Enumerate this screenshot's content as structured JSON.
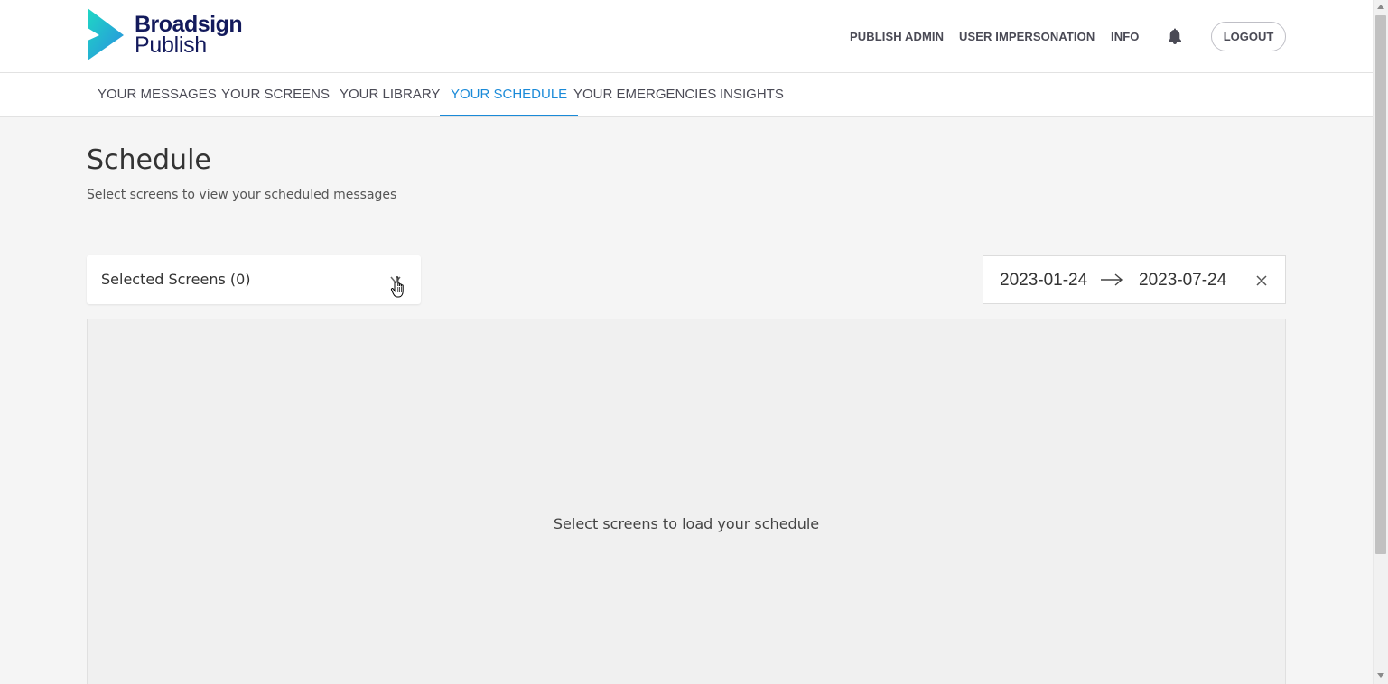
{
  "brand": {
    "line1": "Broadsign",
    "line2": "Publish",
    "gradient_from": "#1ed8c4",
    "gradient_to": "#2a8de0",
    "text_color": "#131a5c"
  },
  "header": {
    "nav": [
      "PUBLISH ADMIN",
      "USER IMPERSONATION",
      "INFO"
    ],
    "bell_icon": "bell-icon",
    "logout_label": "LOGOUT"
  },
  "tabs": {
    "items": [
      {
        "label": "YOUR MESSAGES"
      },
      {
        "label": "YOUR SCREENS"
      },
      {
        "label": "YOUR LIBRARY"
      },
      {
        "label": "YOUR SCHEDULE",
        "active": true
      },
      {
        "label": "YOUR EMERGENCIES"
      },
      {
        "label": "INSIGHTS"
      }
    ],
    "active_color": "#1a8ad8"
  },
  "page": {
    "title": "Schedule",
    "subtitle": "Select screens to view your scheduled messages"
  },
  "screens_select": {
    "label": "Selected Screens (0)",
    "icon": "chevron-down-icon"
  },
  "date_range": {
    "start": "2023-01-24",
    "end": "2023-07-24",
    "arrow_icon": "arrow-right-icon",
    "clear_icon": "close-icon"
  },
  "schedule": {
    "empty_message": "Select screens to load your schedule"
  }
}
